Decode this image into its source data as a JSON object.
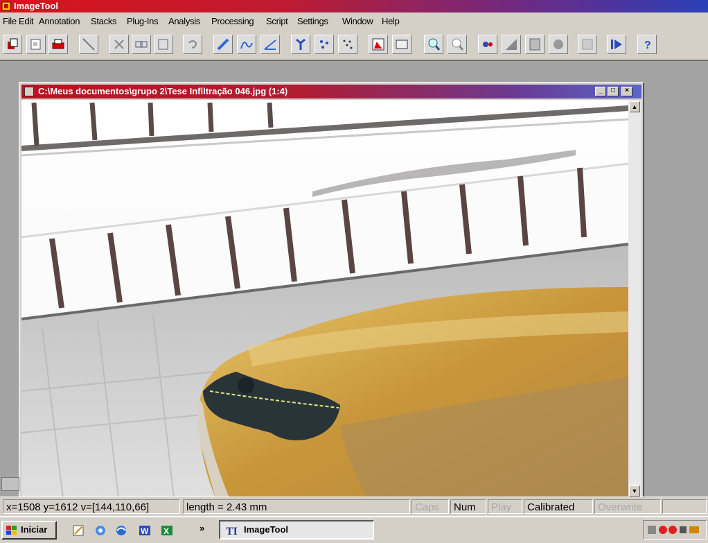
{
  "app": {
    "title": "ImageTool"
  },
  "menu": [
    "File",
    "Edit",
    "Annotation",
    "Stacks",
    "Plug-Ins",
    "Analysis",
    "Processing",
    "Script",
    "Settings",
    "Window",
    "Help"
  ],
  "toolbar": {
    "buttons": [
      "new-doc",
      "open",
      "print",
      "line-tool",
      "cut",
      "copy",
      "paste",
      "undo",
      "pen",
      "freehand",
      "angle",
      "tree",
      "spot",
      "dots",
      "histogram",
      "image-info",
      "zoom-in",
      "zoom-out",
      "blob",
      "gray",
      "calc",
      "pie",
      "texture",
      "play",
      "help"
    ]
  },
  "document": {
    "title": "C:\\Meus documentos\\grupo 2\\Tese Infiltração 046.jpg (1:4)",
    "minimize": "_",
    "maximize": "□",
    "close": "×"
  },
  "status": {
    "coords": "x=1508 y=1612 v=[144,110,66]",
    "measurement": "length = 2.43 mm",
    "caps": "Caps",
    "num": "Num",
    "play": "Play",
    "calibrated": "Calibrated",
    "overwrite": "Overwrite"
  },
  "taskbar": {
    "start_label": "Iniciar",
    "chevron": "»",
    "task_label": "ImageTool"
  },
  "colors": {
    "title_red": "#d8141c",
    "title_blue": "#2a40b8",
    "face": "#d4d0c8"
  }
}
